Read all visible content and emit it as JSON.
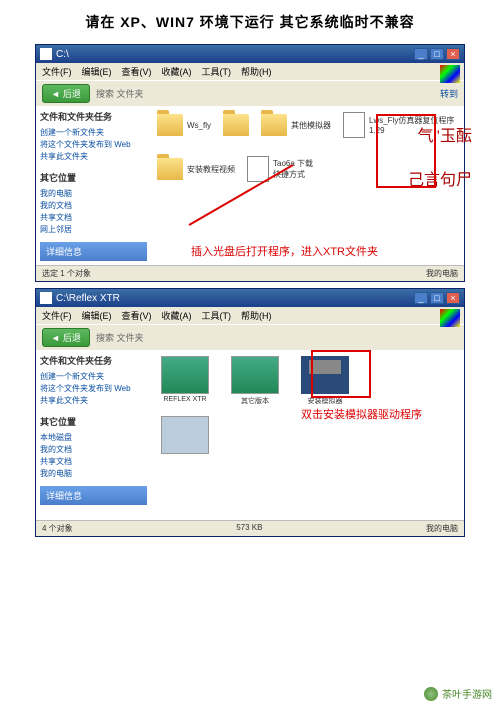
{
  "page_title": "请在 XP、WIN7 环境下运行  其它系统临时不兼容",
  "win1": {
    "title": "C:\\",
    "menu": [
      "文件(F)",
      "编辑(E)",
      "查看(V)",
      "收藏(A)",
      "工具(T)",
      "帮助(H)"
    ],
    "back": "后退",
    "toolbar_extra": "搜索  文件夹",
    "nav_label": "转到",
    "side_head": "文件和文件夹任务",
    "side_items": [
      "创建一个新文件夹",
      "将这个文件夹发布到 Web",
      "共享此文件夹"
    ],
    "side_other_head": "其它位置",
    "side_other": [
      "我的电脑",
      "我的文档",
      "共享文档",
      "网上邻居"
    ],
    "panel": "详细信息",
    "folders": [
      {
        "name": "Ws_fly"
      },
      {
        "name": "其他模拟器"
      },
      {
        "name": "安装教程视频"
      }
    ],
    "files": [
      {
        "name": "Lws_Fly仿真器复位程序\n1.29"
      },
      {
        "name": "Tao6a 下载\n快捷方式"
      }
    ],
    "overlay1": "气\"玉酝",
    "overlay2": "己言句尸",
    "annotation": "插入光盘后打开程序，进入XTR文件夹",
    "status_left": "选定 1 个对象",
    "status_right": "我的电脑"
  },
  "win2": {
    "title": "C:\\Reflex XTR",
    "menu": [
      "文件(F)",
      "编辑(E)",
      "查看(V)",
      "收藏(A)",
      "工具(T)",
      "帮助(H)"
    ],
    "back": "后退",
    "toolbar_extra": "搜索  文件夹",
    "side_head": "文件和文件夹任务",
    "side_items": [
      "创建一个新文件夹",
      "将这个文件夹发布到 Web",
      "共享此文件夹"
    ],
    "side_other_head": "其它位置",
    "side_other": [
      "本地磁盘",
      "我的文档",
      "共享文档",
      "我的电脑"
    ],
    "panel": "详细信息",
    "thumbs": [
      {
        "name": "REFLEX XTR"
      },
      {
        "name": "其它版本"
      },
      {
        "name": "安装模拟器"
      }
    ],
    "annotation": "双击安装模拟器驱动程序",
    "status_left": "4 个对象",
    "status_mid": "573 KB",
    "status_right": "我的电脑"
  },
  "watermark": "茶叶手游网"
}
